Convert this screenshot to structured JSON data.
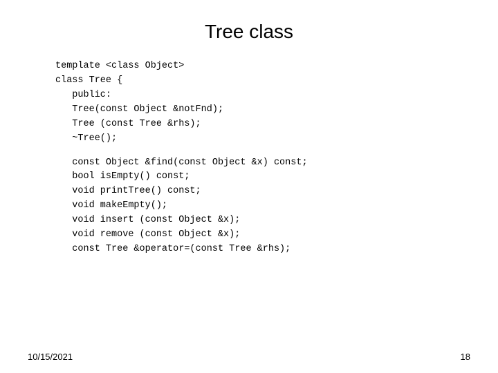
{
  "page": {
    "title": "Tree class",
    "code": {
      "line1": "template <class Object>",
      "line2": "class Tree {",
      "line3": "   public:",
      "line4": "   Tree(const Object &notFnd);",
      "line5": "   Tree (const Tree &rhs);",
      "line6": "   ~Tree();",
      "line7": "",
      "line8": "   const Object &find(const Object &x) const;",
      "line9": "   bool isEmpty() const;",
      "line10": "   void printTree() const;",
      "line11": "   void makeEmpty();",
      "line12": "   void insert (const Object &x);",
      "line13": "   void remove (const Object &x);",
      "line14": "   const Tree &operator=(const Tree &rhs);"
    },
    "footer": {
      "date": "10/15/2021",
      "page_number": "18"
    }
  }
}
